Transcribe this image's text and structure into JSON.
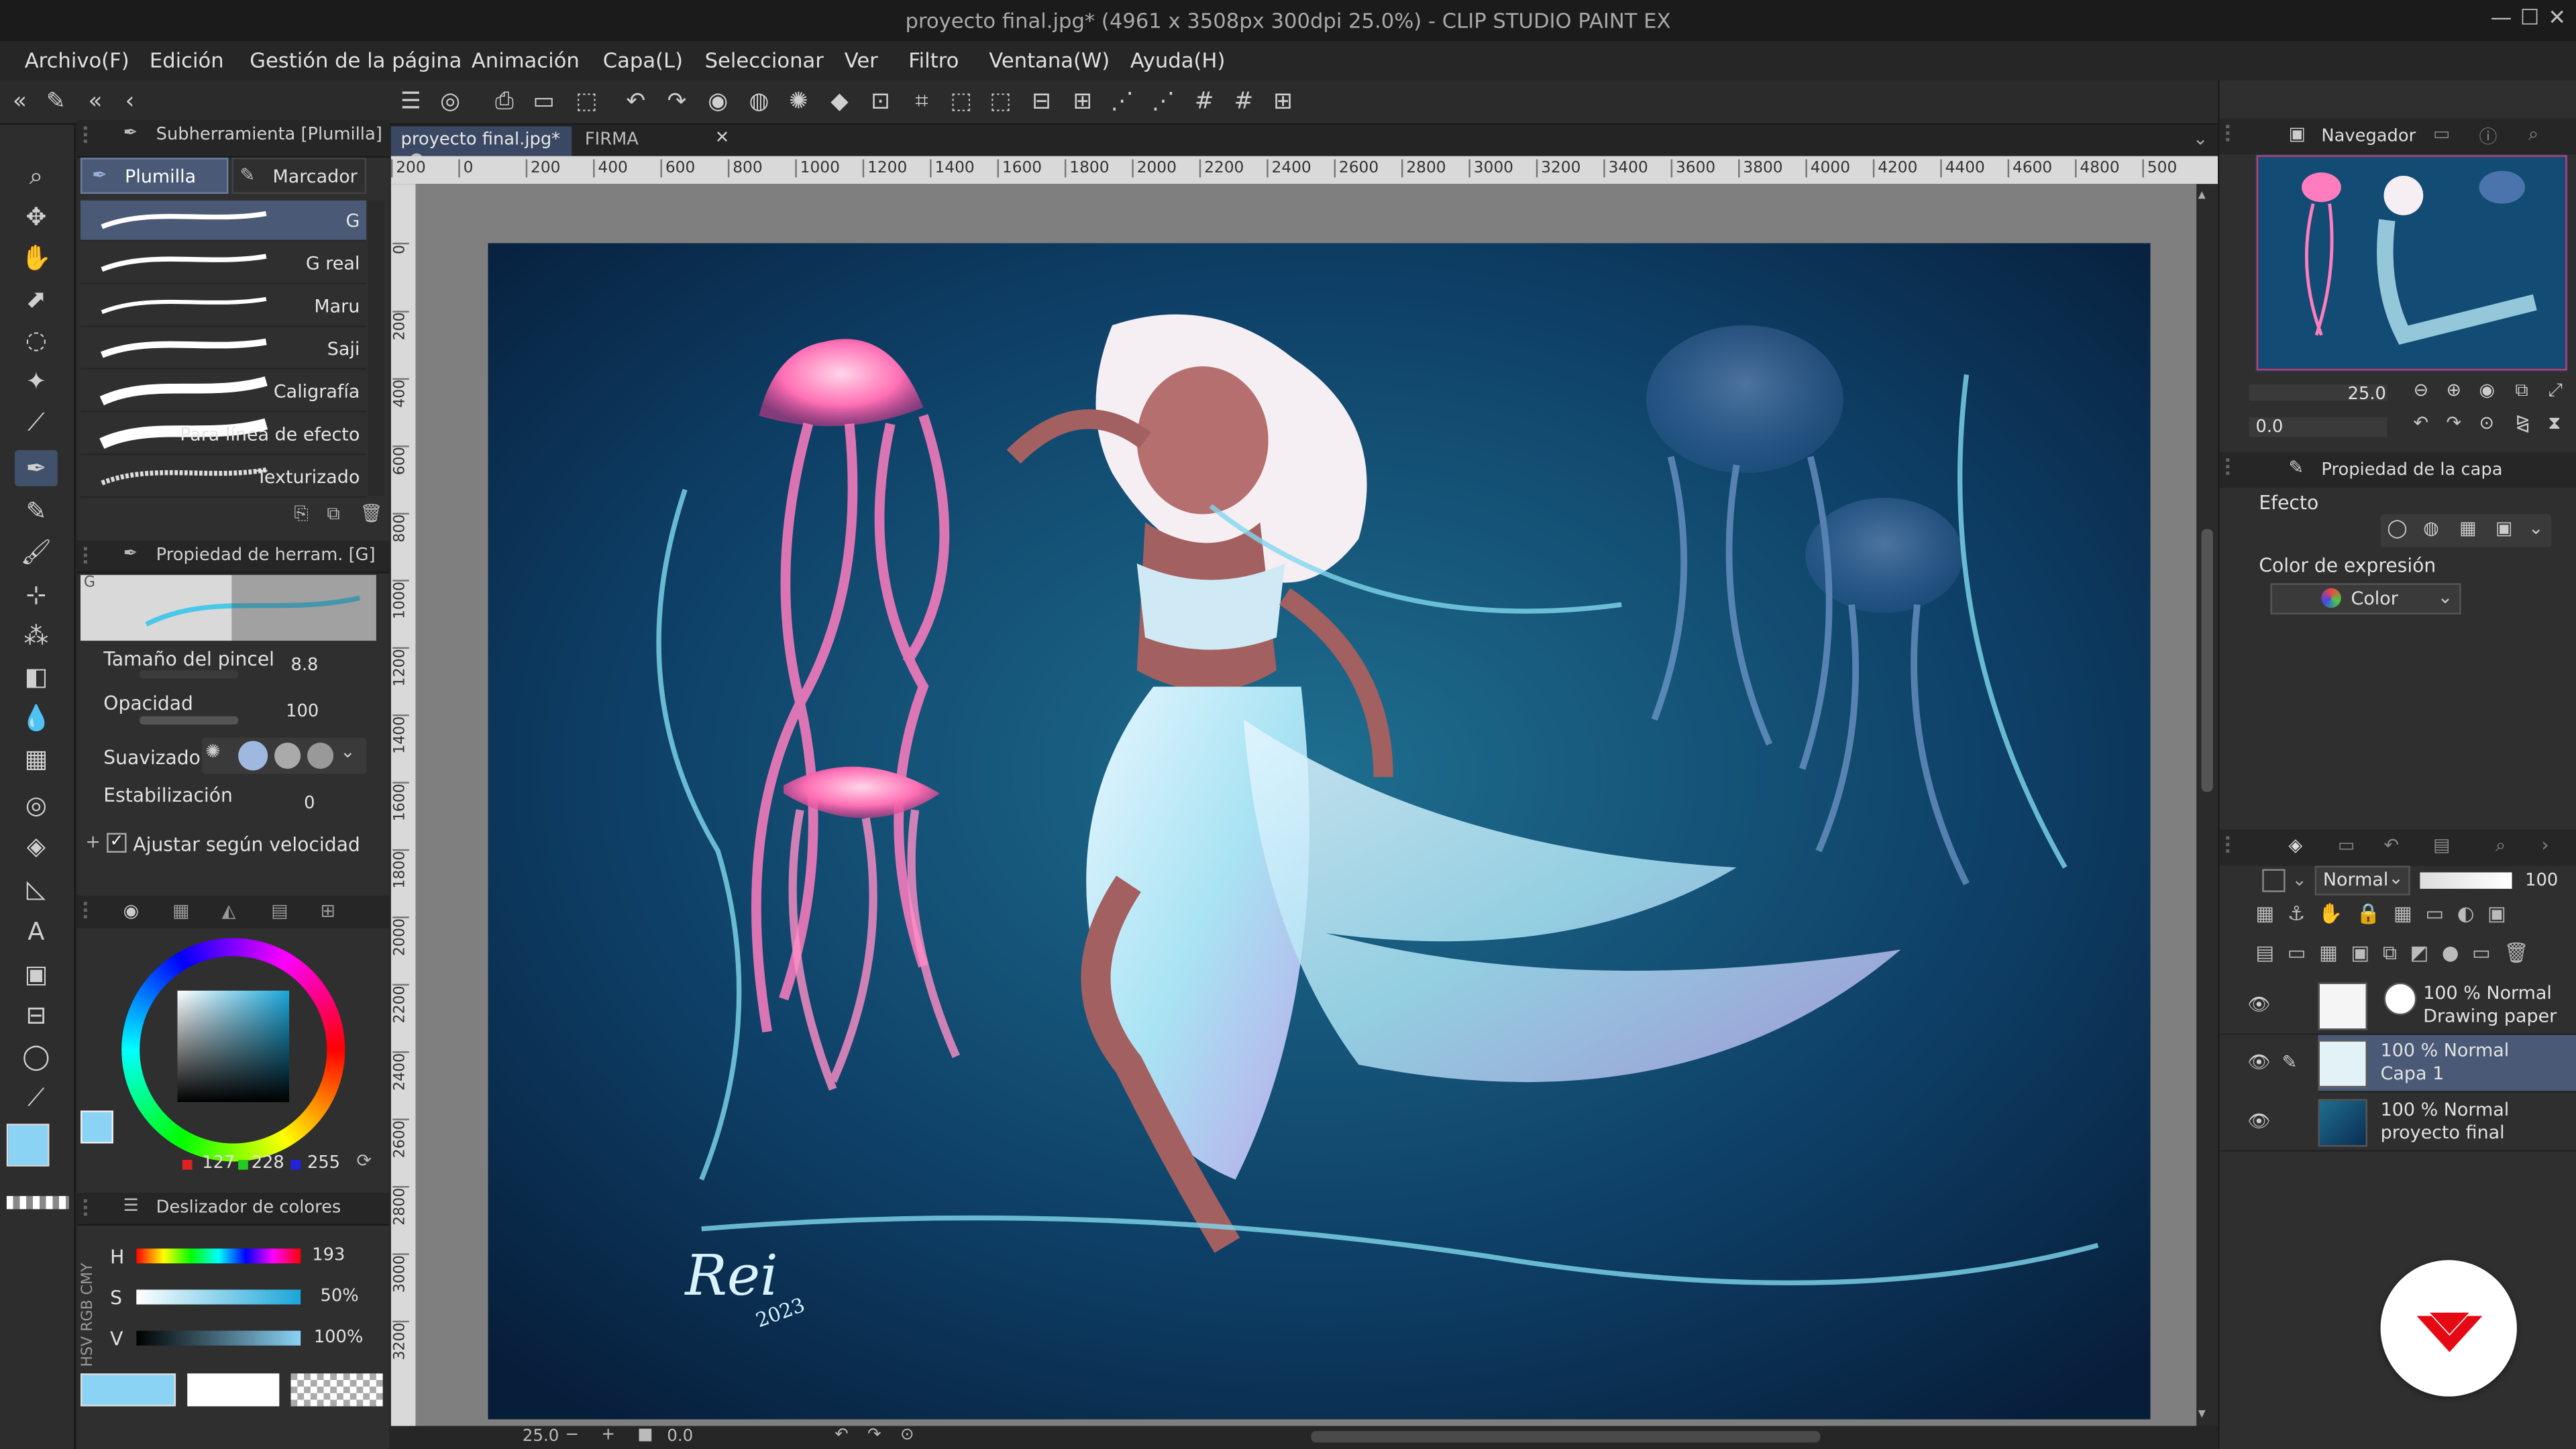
{
  "window": {
    "title": "proyecto final.jpg* (4961 x 3508px 300dpi 25.0%)  - CLIP STUDIO PAINT EX"
  },
  "menu": [
    "Archivo(F)",
    "Edición",
    "Gestión de la página",
    "Animación",
    "Capa(L)",
    "Seleccionar",
    "Ver",
    "Filtro",
    "Ventana(W)",
    "Ayuda(H)"
  ],
  "subtool": {
    "header": "Subherramienta [Plumilla]",
    "tabs": [
      "Plumilla",
      "Marcador"
    ],
    "brushes": [
      "G",
      "G real",
      "Maru",
      "Saji",
      "Caligrafía",
      "Para línea de efecto",
      "Texturizado"
    ]
  },
  "toolprop": {
    "header": "Propiedad de herram. [G]",
    "preview_label": "G",
    "brush_size_label": "Tamaño del pincel",
    "brush_size": "8.8",
    "opacity_label": "Opacidad",
    "opacity": "100",
    "smoothing_label": "Suavizado",
    "stabilization_label": "Estabilización",
    "stabilization": "0",
    "speed_label": "Ajustar según velocidad"
  },
  "color": {
    "main": "#8ad3f5",
    "sub": "#ffffff",
    "rgb": [
      "127",
      "228",
      "255"
    ],
    "slider_header": "Deslizador de colores",
    "side_tabs": "HSV  RGB  CMY",
    "h_label": "H",
    "h": "193",
    "s_label": "S",
    "s": "50%",
    "v_label": "V",
    "v": "100%"
  },
  "document": {
    "tabs": [
      "proyecto final.jpg*",
      "FIRMA"
    ],
    "ruler_labels": [
      "200",
      "0",
      "200",
      "400",
      "600",
      "800",
      "1000",
      "1200",
      "1400",
      "1600",
      "1800",
      "2000",
      "2200",
      "2400",
      "2600",
      "2800",
      "3000",
      "3200",
      "3400",
      "3600",
      "3800",
      "4000",
      "4200",
      "4400",
      "4600",
      "4800",
      "500"
    ],
    "vruler_labels": [
      "0",
      "200",
      "400",
      "600",
      "800",
      "1000",
      "1200",
      "1400",
      "1600",
      "1800",
      "2000",
      "2200",
      "2400",
      "2600",
      "2800",
      "3000",
      "3200"
    ],
    "status_zoom": "25.0",
    "status_angle": "0.0"
  },
  "navigator": {
    "header": "Navegador",
    "zoom": "25.0",
    "angle": "0.0"
  },
  "layerprop": {
    "header": "Propiedad de la capa",
    "effect_label": "Efecto",
    "expression_label": "Color de expresión",
    "expression_value": "Color"
  },
  "layers": {
    "blend": "Normal",
    "opacity": "100",
    "items": [
      {
        "mode": "100 % Normal",
        "name": "Drawing paper"
      },
      {
        "mode": "100 % Normal",
        "name": "Capa 1"
      },
      {
        "mode": "100 % Normal",
        "name": "proyecto final"
      }
    ]
  },
  "colors": {
    "accent": "#4a5a76",
    "logo": "#e50914"
  }
}
